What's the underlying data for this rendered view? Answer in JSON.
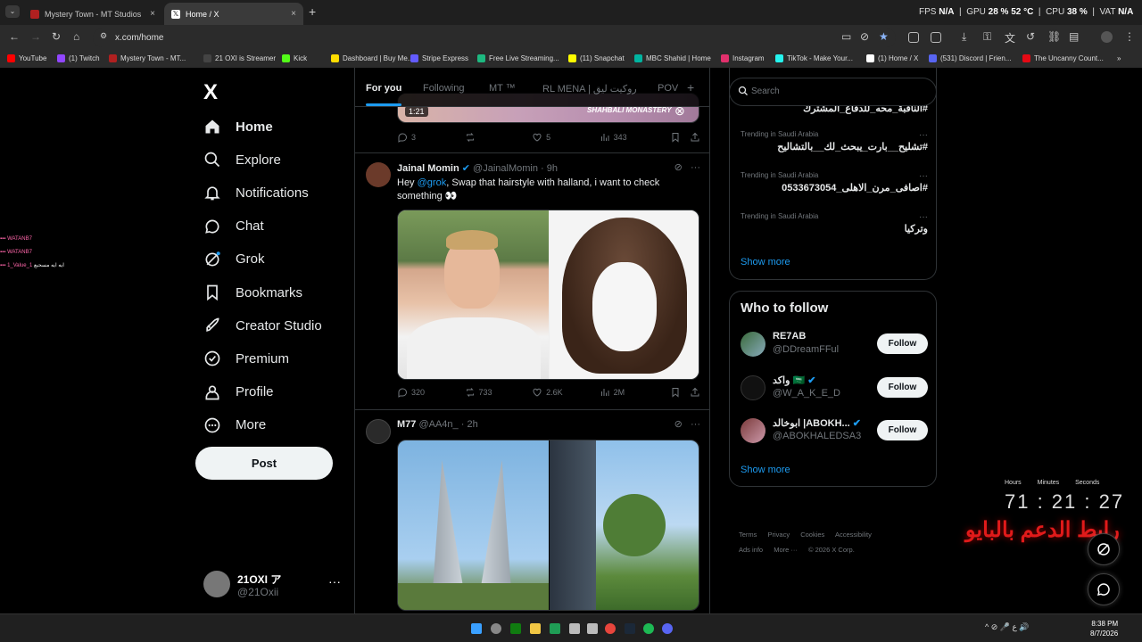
{
  "browser": {
    "tabs": [
      {
        "title": "Mystery Town - MT Studios | M",
        "close": "×"
      },
      {
        "title": "Home / X",
        "close": "×"
      }
    ],
    "new_tab": "+",
    "tab_menu": "⌄",
    "url": "x.com/home",
    "stats": {
      "fps_label": "FPS",
      "fps": "N/A",
      "gpu_label": "GPU",
      "gpu": "28 % 52 °C",
      "cpu_label": "CPU",
      "cpu": "38 %",
      "vat_label": "VAT",
      "vat": "N/A"
    },
    "bookmarks": [
      {
        "label": "YouTube",
        "color": "#ff0000"
      },
      {
        "label": "(1) Twitch",
        "color": "#9146ff"
      },
      {
        "label": "Mystery Town - MT...",
        "color": "#b02020"
      },
      {
        "label": "21 OXI is Streamer",
        "color": "#444444"
      },
      {
        "label": "Kick",
        "color": "#53fc18"
      },
      {
        "label": "Dashboard | Buy Me...",
        "color": "#ffdd00"
      },
      {
        "label": "Stripe Express",
        "color": "#635bff"
      },
      {
        "label": "Free Live Streaming...",
        "color": "#1db980"
      },
      {
        "label": "(11) Snapchat",
        "color": "#fffc00"
      },
      {
        "label": "MBC Shahid | Home",
        "color": "#00b4a0"
      },
      {
        "label": "Instagram",
        "color": "#e1306c"
      },
      {
        "label": "TikTok - Make Your...",
        "color": "#25f4ee"
      },
      {
        "label": "(1) Home / X",
        "color": "#ffffff"
      },
      {
        "label": "(531) Discord | Frien...",
        "color": "#5865f2"
      },
      {
        "label": "The Uncanny Count...",
        "color": "#e50914"
      }
    ],
    "bookmarks_more": "»"
  },
  "chat_overlay": [
    {
      "user": "WATANB7",
      "text": ""
    },
    {
      "user": "WATANB7",
      "text": ""
    },
    {
      "user": "1_Value_1",
      "text": "ايه ايه مسحبع"
    }
  ],
  "sidebar": {
    "logo": "X",
    "items": [
      {
        "label": "Home",
        "icon": "home-icon"
      },
      {
        "label": "Explore",
        "icon": "search-icon"
      },
      {
        "label": "Notifications",
        "icon": "bell-icon"
      },
      {
        "label": "Chat",
        "icon": "chat-icon"
      },
      {
        "label": "Grok",
        "icon": "grok-icon"
      },
      {
        "label": "Bookmarks",
        "icon": "bookmark-icon"
      },
      {
        "label": "Creator Studio",
        "icon": "rocket-icon"
      },
      {
        "label": "Premium",
        "icon": "verified-icon"
      },
      {
        "label": "Profile",
        "icon": "person-icon"
      },
      {
        "label": "More",
        "icon": "more-circle-icon"
      }
    ],
    "post_label": "Post",
    "account": {
      "name": "21OXI ア",
      "handle": "@21Oxii",
      "menu": "···"
    }
  },
  "feed": {
    "tabs": [
      "For you",
      "Following",
      "MT ™",
      "RL MENA | روكيت ليق",
      "POV"
    ],
    "add_tab": "+",
    "tweets": [
      {
        "video_time": "1:21",
        "video_caption": "SHAHBALI MONASTERY",
        "replies": "3",
        "reposts": "",
        "likes": "5",
        "views": "343"
      },
      {
        "name": "Jainal Momin",
        "handle": "@JainalMomin",
        "time": "· 9h",
        "text_before": "Hey ",
        "mention": "@grok",
        "text_after": ", Swap that hairstyle with halland, i want to check something 👀",
        "replies": "320",
        "reposts": "733",
        "likes": "2.6K",
        "views": "2M"
      },
      {
        "name": "M77",
        "handle": "@AA4n_",
        "time": "· 2h"
      }
    ]
  },
  "right": {
    "search_placeholder": "Search",
    "trends": [
      {
        "context": "",
        "title": "#الناقبة_محه_للدفاع_المشترك"
      },
      {
        "context": "Trending in Saudi Arabia",
        "title": "#تشليح__بارت_يبحث_لك__بالتشاليح"
      },
      {
        "context": "Trending in Saudi Arabia",
        "title": "#اصافى_مرن_الاهلى_0533673054"
      },
      {
        "context": "Trending in Saudi Arabia",
        "title": "وتركيا"
      }
    ],
    "trend_more": "···",
    "show_more": "Show more",
    "who_to_follow": {
      "title": "Who to follow",
      "accounts": [
        {
          "name": "RE7AB",
          "handle": "@DDreamFFul",
          "button": "Follow"
        },
        {
          "name": "واكد 🇸🇦",
          "handle": "@W_A_K_E_D",
          "button": "Follow"
        },
        {
          "name": "ابوخالد |ABOKH...",
          "handle": "@ABOKHALEDSA3",
          "button": "Follow"
        }
      ],
      "show_more": "Show more"
    },
    "footer": [
      "Terms",
      "Privacy",
      "Cookies",
      "Accessibility",
      "Ads info",
      "More ···",
      "© 2026 X Corp."
    ]
  },
  "timer_overlay": {
    "labels": [
      "Hours",
      "Minutes",
      "Seconds"
    ],
    "value": "71 : 21 : 27",
    "promo": "رابط الدعم بالبايو"
  },
  "taskbar": {
    "time": "8:38 PM",
    "date": "8/7/2026",
    "tray": "^  ⊘  🎤  ع  🔊"
  }
}
